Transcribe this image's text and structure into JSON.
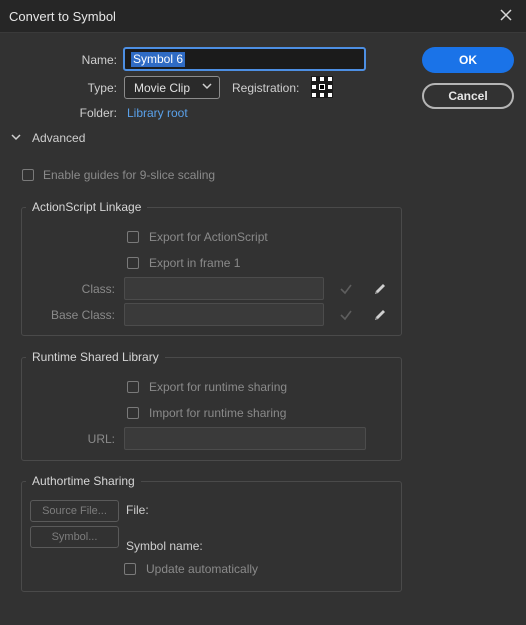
{
  "dialog": {
    "title": "Convert to Symbol"
  },
  "icons": {
    "close": "close-icon",
    "chevron_down": "chevron-down-icon",
    "caret_advanced": "chevron-down-icon",
    "check": "check-icon",
    "pencil": "pencil-icon",
    "registration": "registration-grid-icon"
  },
  "colors": {
    "accent": "#1a73e8",
    "link": "#5aa1ea",
    "background": "#323232",
    "selection": "#2f6bc4"
  },
  "form": {
    "name_label": "Name:",
    "name_value": "Symbol 6",
    "type_label": "Type:",
    "type_value": "Movie Clip",
    "registration_label": "Registration:",
    "folder_label": "Folder:",
    "folder_value": "Library root"
  },
  "buttons": {
    "ok": "OK",
    "cancel": "Cancel"
  },
  "advanced": {
    "toggle_label": "Advanced",
    "nine_slice_label": "Enable guides for 9-slice scaling",
    "actionscript": {
      "title": "ActionScript Linkage",
      "export_actionscript": "Export for ActionScript",
      "export_frame1": "Export in frame 1",
      "class_label": "Class:",
      "base_class_label": "Base Class:"
    },
    "runtime": {
      "title": "Runtime Shared Library",
      "export_runtime": "Export for runtime sharing",
      "import_runtime": "Import for runtime sharing",
      "url_label": "URL:"
    },
    "authortime": {
      "title": "Authortime Sharing",
      "source_file_button": "Source File...",
      "symbol_button": "Symbol...",
      "file_label": "File:",
      "symbol_name_label": "Symbol name:",
      "update_label": "Update automatically"
    }
  }
}
